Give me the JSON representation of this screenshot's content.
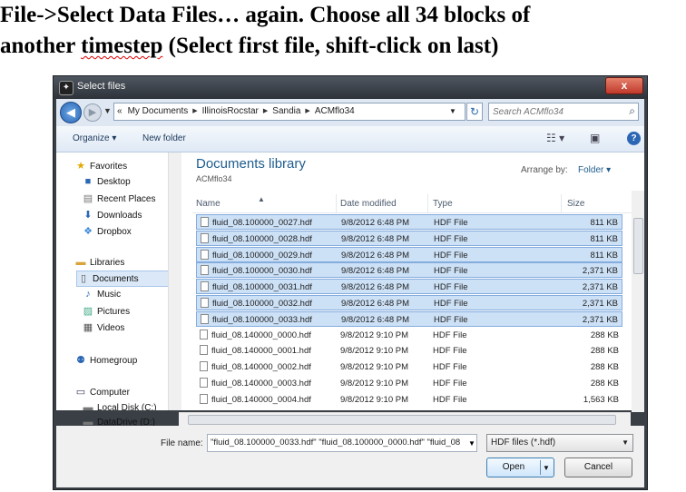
{
  "instruction": {
    "line1": "File->Select Data Files…  again. Choose all 34 blocks of",
    "line2_start": "another ",
    "line2_word": "timestep",
    "line2_end": " (Select first file, shift-click on last)"
  },
  "dialog": {
    "title": "Select files",
    "close_label": "x",
    "breadcrumb": [
      "My Documents",
      "IllinoisRocstar",
      "Sandia",
      "ACMflo34"
    ],
    "search_placeholder": "Search ACMflo34",
    "toolbar": {
      "organize": "Organize ▾",
      "new_folder": "New folder",
      "help": "?"
    },
    "library": {
      "title": "Documents library",
      "subtitle": "ACMflo34",
      "arrange_label": "Arrange by:",
      "arrange_value": "Folder ▾"
    },
    "columns": {
      "name": "Name",
      "date": "Date modified",
      "type": "Type",
      "size": "Size"
    },
    "nav": {
      "favorites": "Favorites",
      "desktop": "Desktop",
      "recent": "Recent Places",
      "downloads": "Downloads",
      "dropbox": "Dropbox",
      "libraries": "Libraries",
      "documents": "Documents",
      "music": "Music",
      "pictures": "Pictures",
      "videos": "Videos",
      "homegroup": "Homegroup",
      "computer": "Computer",
      "local_disk": "Local Disk (C:)",
      "data_drive": "DataDrive (D:)"
    },
    "files": [
      {
        "name": "fluid_08.100000_0027.hdf",
        "date": "9/8/2012 6:48 PM",
        "type": "HDF File",
        "size": "811 KB",
        "selected": true
      },
      {
        "name": "fluid_08.100000_0028.hdf",
        "date": "9/8/2012 6:48 PM",
        "type": "HDF File",
        "size": "811 KB",
        "selected": true
      },
      {
        "name": "fluid_08.100000_0029.hdf",
        "date": "9/8/2012 6:48 PM",
        "type": "HDF File",
        "size": "811 KB",
        "selected": true
      },
      {
        "name": "fluid_08.100000_0030.hdf",
        "date": "9/8/2012 6:48 PM",
        "type": "HDF File",
        "size": "2,371 KB",
        "selected": true
      },
      {
        "name": "fluid_08.100000_0031.hdf",
        "date": "9/8/2012 6:48 PM",
        "type": "HDF File",
        "size": "2,371 KB",
        "selected": true
      },
      {
        "name": "fluid_08.100000_0032.hdf",
        "date": "9/8/2012 6:48 PM",
        "type": "HDF File",
        "size": "2,371 KB",
        "selected": true
      },
      {
        "name": "fluid_08.100000_0033.hdf",
        "date": "9/8/2012 6:48 PM",
        "type": "HDF File",
        "size": "2,371 KB",
        "selected": true
      },
      {
        "name": "fluid_08.140000_0000.hdf",
        "date": "9/8/2012 9:10 PM",
        "type": "HDF File",
        "size": "288 KB",
        "selected": false
      },
      {
        "name": "fluid_08.140000_0001.hdf",
        "date": "9/8/2012 9:10 PM",
        "type": "HDF File",
        "size": "288 KB",
        "selected": false
      },
      {
        "name": "fluid_08.140000_0002.hdf",
        "date": "9/8/2012 9:10 PM",
        "type": "HDF File",
        "size": "288 KB",
        "selected": false
      },
      {
        "name": "fluid_08.140000_0003.hdf",
        "date": "9/8/2012 9:10 PM",
        "type": "HDF File",
        "size": "288 KB",
        "selected": false
      },
      {
        "name": "fluid_08.140000_0004.hdf",
        "date": "9/8/2012 9:10 PM",
        "type": "HDF File",
        "size": "1,563 KB",
        "selected": false
      }
    ],
    "file_name_label": "File name:",
    "file_name_value": "\"fluid_08.100000_0033.hdf\" \"fluid_08.100000_0000.hdf\" \"fluid_08",
    "filter_value": "HDF files (*.hdf)",
    "open_label": "Open",
    "cancel_label": "Cancel"
  }
}
